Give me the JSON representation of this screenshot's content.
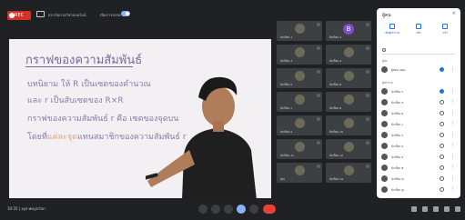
{
  "topbar": {
    "rec_label": "REC",
    "title": "สถาบันกวดวิชาออนไลน์",
    "subtitle": "เปิดการบรรยาย"
  },
  "slide": {
    "title": "กราฟของความสัมพันธ์",
    "line1": "บทนิยาม ให้ R เป็นเซตของคำนวณ",
    "line2": "และ r เป็นสับเซตของ R×R",
    "line3": "กราฟของความสัมพันธ์ r คือ เซตของจุดบน",
    "line4_a": "โดยที่",
    "line4_hl": "แต่ละจุด",
    "line4_b": "แทนสมาชิกของความสัมพันธ์ r"
  },
  "tiles": [
    {
      "name": "นักเรียน 1"
    },
    {
      "name": "นักเรียน 2",
      "letter": "B"
    },
    {
      "name": "นักเรียน 3"
    },
    {
      "name": "นักเรียน 4"
    },
    {
      "name": "นักเรียน 5"
    },
    {
      "name": "นักเรียน 6"
    },
    {
      "name": "นักเรียน 7"
    },
    {
      "name": "นักเรียน 8"
    },
    {
      "name": "นักเรียน 9"
    },
    {
      "name": "นักเรียน 10"
    },
    {
      "name": "นักเรียน 11"
    },
    {
      "name": "นักเรียน 12"
    },
    {
      "name": "คุณ"
    },
    {
      "name": "นักเรียน 14"
    }
  ],
  "bottombar": {
    "clock": "10:35 | xyz-wxyz-txn"
  },
  "panel": {
    "title": "ผู้คน",
    "close": "×",
    "buttons": [
      "เพิ่มผู้เข้าร่วม",
      "เพิ่ม",
      "แชร์"
    ],
    "search_placeholder": "",
    "section1": "ผู้จัด",
    "section2": "ผู้เข้าร่วม",
    "people": [
      {
        "name": "ผู้สอน (คุณ)",
        "mic": "on"
      },
      {
        "name": "นักเรียน ก",
        "mic": "on"
      },
      {
        "name": "นักเรียน ข",
        "mic": "off"
      },
      {
        "name": "นักเรียน ค",
        "mic": "off"
      },
      {
        "name": "นักเรียน ง",
        "mic": "off"
      },
      {
        "name": "นักเรียน จ",
        "mic": "off"
      },
      {
        "name": "นักเรียน ฉ",
        "mic": "off"
      },
      {
        "name": "นักเรียน ช",
        "mic": "off"
      },
      {
        "name": "นักเรียน ซ",
        "mic": "off"
      },
      {
        "name": "นักเรียน ฌ",
        "mic": "off"
      },
      {
        "name": "นักเรียน ญ",
        "mic": "off"
      }
    ]
  },
  "colors": {
    "background": "#202124",
    "slide_text": "#8a7aa8",
    "highlight": "#e0a58c",
    "record": "#d93025",
    "hangup": "#ea4335",
    "accent": "#1a73e8"
  }
}
